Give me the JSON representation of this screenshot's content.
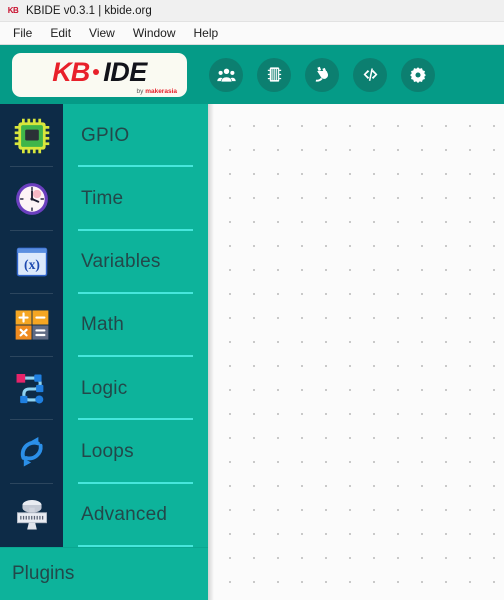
{
  "window": {
    "favicon_text": "KB",
    "favicon_name": "kbide-favicon",
    "title": "KBIDE v0.3.1 | kbide.org"
  },
  "menubar": {
    "items": [
      {
        "label": "File",
        "name": "menu-file"
      },
      {
        "label": "Edit",
        "name": "menu-edit"
      },
      {
        "label": "View",
        "name": "menu-view"
      },
      {
        "label": "Window",
        "name": "menu-window"
      },
      {
        "label": "Help",
        "name": "menu-help"
      }
    ]
  },
  "header": {
    "logo": {
      "kb": "KB",
      "ide": "IDE",
      "byline_prefix": "by ",
      "byline_brand": "makerasia"
    },
    "toolbar": [
      {
        "label": "Community",
        "icon": "users-icon"
      },
      {
        "label": "Board",
        "icon": "chip-icon"
      },
      {
        "label": "Port",
        "icon": "plug-icon"
      },
      {
        "label": "Code",
        "icon": "code-icon"
      },
      {
        "label": "Settings",
        "icon": "gear-icon"
      }
    ]
  },
  "sidebar": {
    "categories": [
      {
        "label": "GPIO",
        "icon": "gpio-chip-icon"
      },
      {
        "label": "Time",
        "icon": "clock-icon"
      },
      {
        "label": "Variables",
        "icon": "variable-x-icon"
      },
      {
        "label": "Math",
        "icon": "calculator-icon"
      },
      {
        "label": "Logic",
        "icon": "logic-nodes-icon"
      },
      {
        "label": "Loops",
        "icon": "loop-arrows-icon"
      },
      {
        "label": "Advanced",
        "icon": "ic-package-icon"
      }
    ],
    "plugins_label": "Plugins"
  },
  "colors": {
    "header_teal": "#059b87",
    "sidebar_teal": "#0db39b",
    "icon_column_navy": "#0d2b47",
    "divider_cyan": "#46e6dc",
    "label_text": "#23484a",
    "toolbar_btn": "#0c7f70",
    "logo_red": "#e8202a",
    "canvas_bg": "#fbfbfb",
    "canvas_dot": "#c9c9c9"
  }
}
